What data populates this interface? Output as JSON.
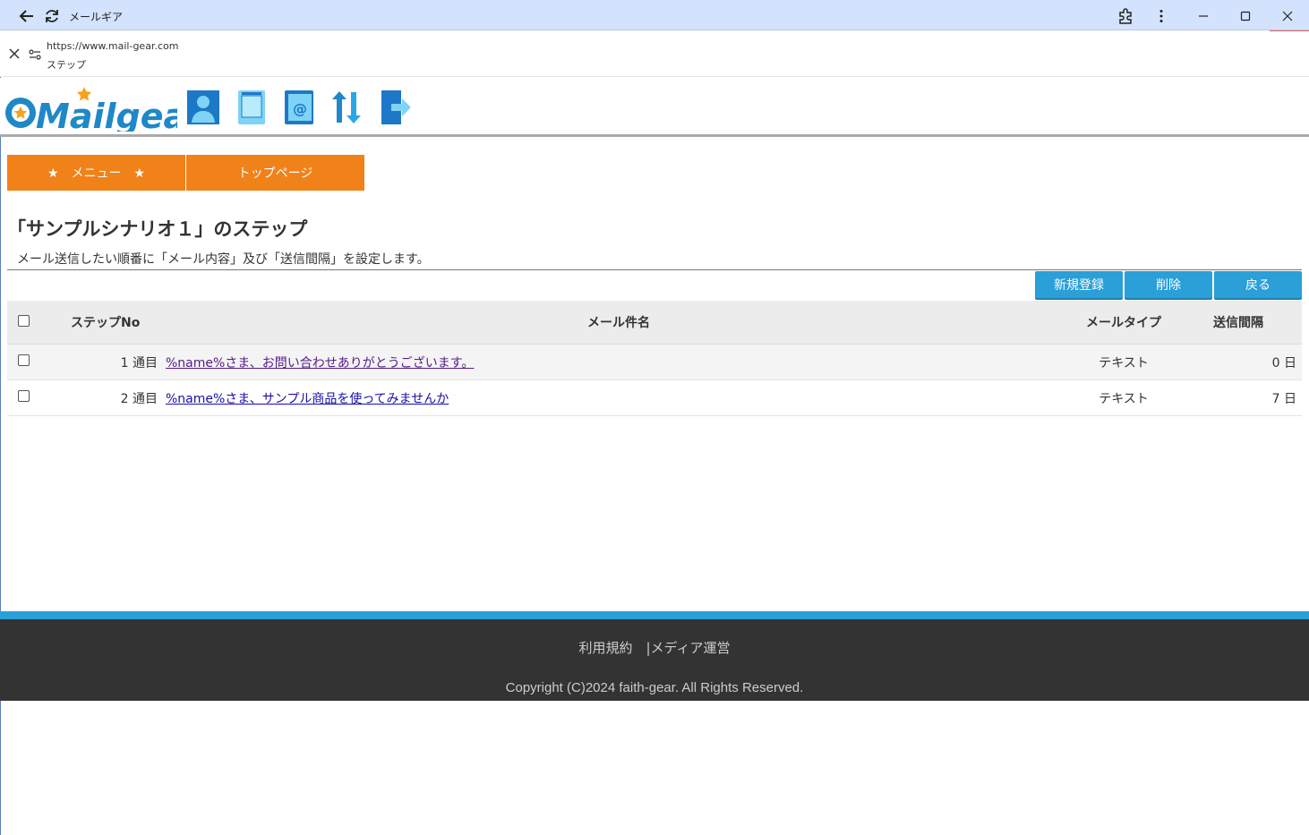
{
  "window": {
    "title": "メールギア"
  },
  "address_bar": {
    "url": "https://www.mail-gear.com",
    "page_name": "ステップ"
  },
  "nav_tabs": [
    {
      "label": "★　メニュー　★"
    },
    {
      "label": "トップページ"
    }
  ],
  "page": {
    "title": "「サンプルシナリオ１」のステップ",
    "description": "メール送信したい順番に「メール内容」及び「送信間隔」を設定します。"
  },
  "actions": {
    "new_label": "新規登録",
    "delete_label": "削除",
    "back_label": "戻る"
  },
  "table": {
    "headers": {
      "step_no": "ステップNo",
      "subject": "メール件名",
      "mail_type": "メールタイプ",
      "interval": "送信間隔"
    },
    "rows": [
      {
        "no": "1 通目",
        "subject": "%name%さま、お問い合わせありがとうございます。",
        "type": "テキスト",
        "interval": "0 日"
      },
      {
        "no": "2 通目",
        "subject": "%name%さま、サンプル商品を使ってみませんか",
        "type": "テキスト",
        "interval": "7 日"
      }
    ]
  },
  "footer": {
    "links": "利用規約　|メディア運営",
    "copyright": "Copyright (C)2024 faith-gear. All Rights Reserved."
  },
  "colors": {
    "accent_orange": "#f08219",
    "accent_blue": "#2a9fd8",
    "footer_bg": "#333333"
  },
  "icons": [
    "back-arrow-icon",
    "reload-icon",
    "extensions-icon",
    "more-icon",
    "minimize-icon",
    "maximize-icon",
    "close-icon",
    "site-settings-icon",
    "user-icon",
    "tablet-icon",
    "address-book-icon",
    "sync-icon",
    "logout-icon"
  ]
}
